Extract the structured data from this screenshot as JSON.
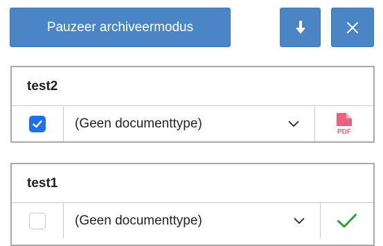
{
  "toolbar": {
    "pause_label": "Pauzeer archiveermodus",
    "download_icon": "arrow-down-icon",
    "close_icon": "close-icon"
  },
  "documents": [
    {
      "title": "test2",
      "checked": true,
      "document_type": "(Geen documenttype)",
      "status_icon": "pdf-file-icon",
      "status_icon_text": "PDF"
    },
    {
      "title": "test1",
      "checked": false,
      "document_type": "(Geen documenttype)",
      "status_icon": "checkmark-icon"
    }
  ],
  "colors": {
    "primary_button": "#4a86c5",
    "checkbox_checked": "#1f6fe5",
    "pdf_icon": "#e8637f",
    "success_check": "#2e9e3a"
  }
}
